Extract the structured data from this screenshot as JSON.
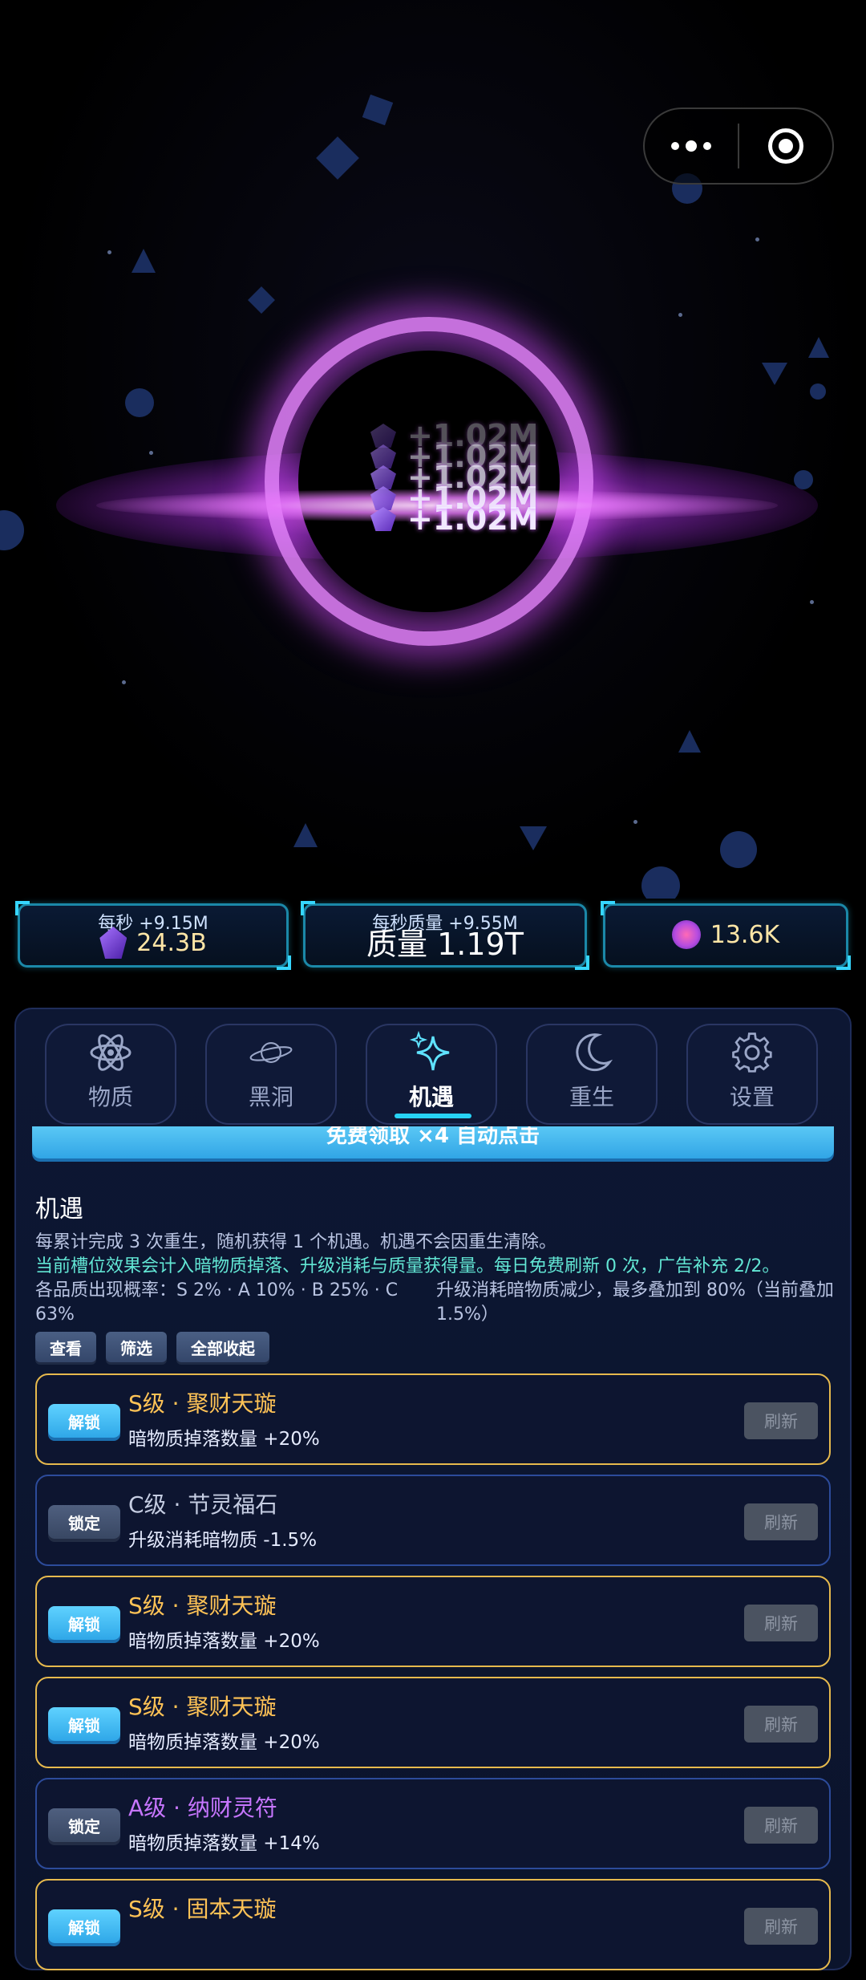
{
  "floating_gains": [
    "+1.02M",
    "+1.02M",
    "+1.02M",
    "+1.02M",
    "+1.02M"
  ],
  "stats": {
    "dark_matter": {
      "rate": "每秒 +9.15M",
      "value": "24.3B"
    },
    "mass": {
      "rate": "每秒质量 +9.55M",
      "value": "质量 1.19T"
    },
    "hearts": {
      "value": "13.6K"
    }
  },
  "tabs": [
    {
      "label": "物质",
      "icon": "atom-icon"
    },
    {
      "label": "黑洞",
      "icon": "planet-icon"
    },
    {
      "label": "机遇",
      "icon": "sparkle-icon",
      "active": true
    },
    {
      "label": "重生",
      "icon": "moon-icon"
    },
    {
      "label": "设置",
      "icon": "gear-icon"
    }
  ],
  "free_claim_label": "免费领取 ×4 自动点击",
  "content": {
    "title": "机遇",
    "line1": "每累计完成 3 次重生，随机获得 1 个机遇。机遇不会因重生清除。",
    "line2": "当前槽位效果会计入暗物质掉落、升级消耗与质量获得量。每日免费刷新 0 次，广告补充 2/2。",
    "rates": "各品质出现概率：S 2% · A 10% · B 25% · C 63%",
    "summary": "升级消耗暗物质减少，最多叠加到 80%（当前叠加 1.5%）",
    "buttons": {
      "view": "查看",
      "filter": "筛选",
      "collapse": "全部收起"
    }
  },
  "cards": [
    {
      "status": "解锁",
      "tier": "s",
      "name": "S级 · 聚财天璇",
      "desc": "暗物质掉落数量 +20%",
      "refresh": "刷新"
    },
    {
      "status": "锁定",
      "tier": "c",
      "name": "C级 · 节灵福石",
      "desc": "升级消耗暗物质 -1.5%",
      "refresh": "刷新"
    },
    {
      "status": "解锁",
      "tier": "s",
      "name": "S级 · 聚财天璇",
      "desc": "暗物质掉落数量 +20%",
      "refresh": "刷新"
    },
    {
      "status": "解锁",
      "tier": "s",
      "name": "S级 · 聚财天璇",
      "desc": "暗物质掉落数量 +20%",
      "refresh": "刷新"
    },
    {
      "status": "锁定",
      "tier": "a",
      "name": "A级 · 纳财灵符",
      "desc": "暗物质掉落数量 +14%",
      "refresh": "刷新"
    },
    {
      "status": "解锁",
      "tier": "s",
      "name": "S级 · 固本天璇",
      "desc": "",
      "refresh": "刷新"
    }
  ],
  "colors": {
    "s_tier": "#ffc356",
    "a_tier": "#c776ff",
    "c_tier": "#c5cde2",
    "accent": "#27d3f5",
    "gold_border": "#e6b94d",
    "blue_border": "#2c4b9a"
  }
}
